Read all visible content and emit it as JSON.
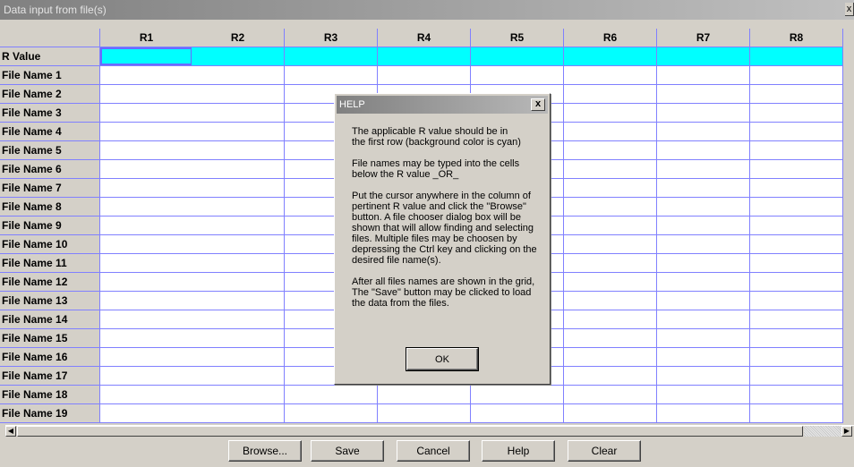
{
  "window": {
    "title": "Data input from file(s)",
    "close_glyph": "x"
  },
  "grid": {
    "columns": [
      "R1",
      "R2",
      "R3",
      "R4",
      "R5",
      "R6",
      "R7",
      "R8"
    ],
    "value_row_label": "R Value",
    "value_row_color": "#00ffff",
    "file_rows": [
      "File Name 1",
      "File Name 2",
      "File Name 3",
      "File Name 4",
      "File Name 5",
      "File Name 6",
      "File Name 7",
      "File Name 8",
      "File Name 9",
      "File Name 10",
      "File Name 11",
      "File Name 12",
      "File Name 13",
      "File Name 14",
      "File Name 15",
      "File Name 16",
      "File Name 17",
      "File Name 18",
      "File Name 19"
    ]
  },
  "buttons": {
    "browse": "Browse...",
    "save": "Save",
    "cancel": "Cancel",
    "help": "Help",
    "clear": "Clear"
  },
  "help_dialog": {
    "title": "HELP",
    "close_glyph": "x",
    "paragraphs": [
      "The applicable R value should be in\nthe first row (background color is cyan)",
      "File names may be typed into the cells\nbelow the R value _OR_",
      "Put the cursor anywhere in the column of\npertinent R value and click the \"Browse\"\nbutton.  A file chooser dialog box will be\nshown that will allow finding and selecting\nfiles.  Multiple files may be choosen by\ndepressing the Ctrl key and clicking on the\ndesired file name(s).",
      "After all files names are shown in the grid,\nThe \"Save\" button may be clicked to load\nthe data from the files."
    ],
    "ok_label": "OK"
  }
}
